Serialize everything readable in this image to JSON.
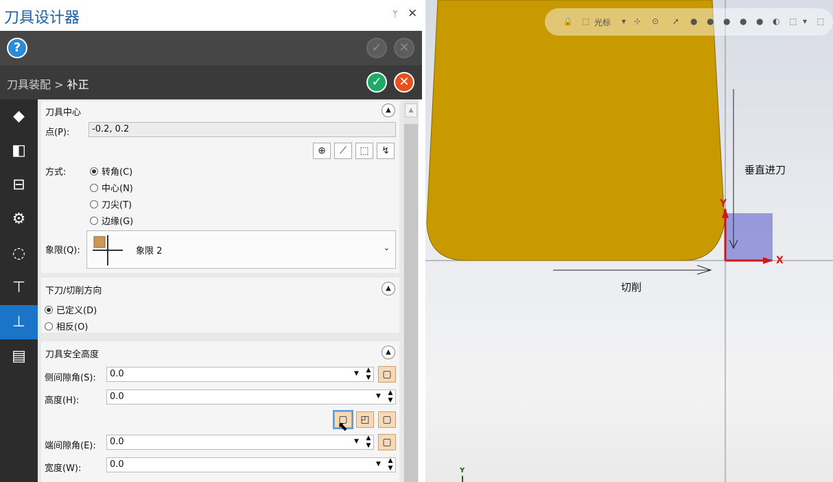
{
  "window": {
    "title": "刀具设计器",
    "pin_icon": "pin-icon",
    "close_icon": "close-icon"
  },
  "header": {
    "help_icon": "help-icon"
  },
  "breadcrumb": {
    "parent": "刀具装配",
    "separator": ">",
    "current": "补正"
  },
  "sidebar": {
    "items": [
      {
        "name": "insert-icon",
        "glyph": "◆"
      },
      {
        "name": "holder-icon",
        "glyph": "◧"
      },
      {
        "name": "assembly-icon",
        "glyph": "⊟"
      },
      {
        "name": "settings-icon",
        "glyph": "⚙"
      },
      {
        "name": "sweep-icon",
        "glyph": "◌"
      },
      {
        "name": "clamp-icon",
        "glyph": "⊤"
      },
      {
        "name": "offset-icon",
        "glyph": "⊥"
      },
      {
        "name": "report-icon",
        "glyph": "▤"
      }
    ],
    "active_index": 6
  },
  "tool_center": {
    "title": "刀具中心",
    "point_label": "点(P):",
    "point_value": "-0.2, 0.2",
    "method_label": "方式:",
    "methods": [
      "转角(C)",
      "中心(N)",
      "刀尖(T)",
      "边缘(G)"
    ],
    "method_selected": 0,
    "quadrant_label": "象限(Q):",
    "quadrant_value": "象限 2"
  },
  "direction": {
    "title": "下刀/切削方向",
    "options": [
      "已定义(D)",
      "相反(O)"
    ],
    "selected": 0
  },
  "safety": {
    "title": "刀具安全高度",
    "side_clearance_label": "侧间隙角(S):",
    "side_clearance_value": "0.0",
    "height_label": "高度(H):",
    "height_value": "0.0",
    "end_clearance_label": "端间隙角(E):",
    "end_clearance_value": "0.0",
    "width_label": "宽度(W):",
    "width_value": "0.0"
  },
  "viewport": {
    "toolbar_cursor_label": "光标",
    "vertical_label": "垂直进刀",
    "cut_label": "切削",
    "axis_x": "X",
    "axis_y": "Y",
    "small_axis_y": "Y",
    "tool_color": "#c99a00",
    "box_color": "#7b7fd4",
    "axis_color": "#d01818"
  }
}
